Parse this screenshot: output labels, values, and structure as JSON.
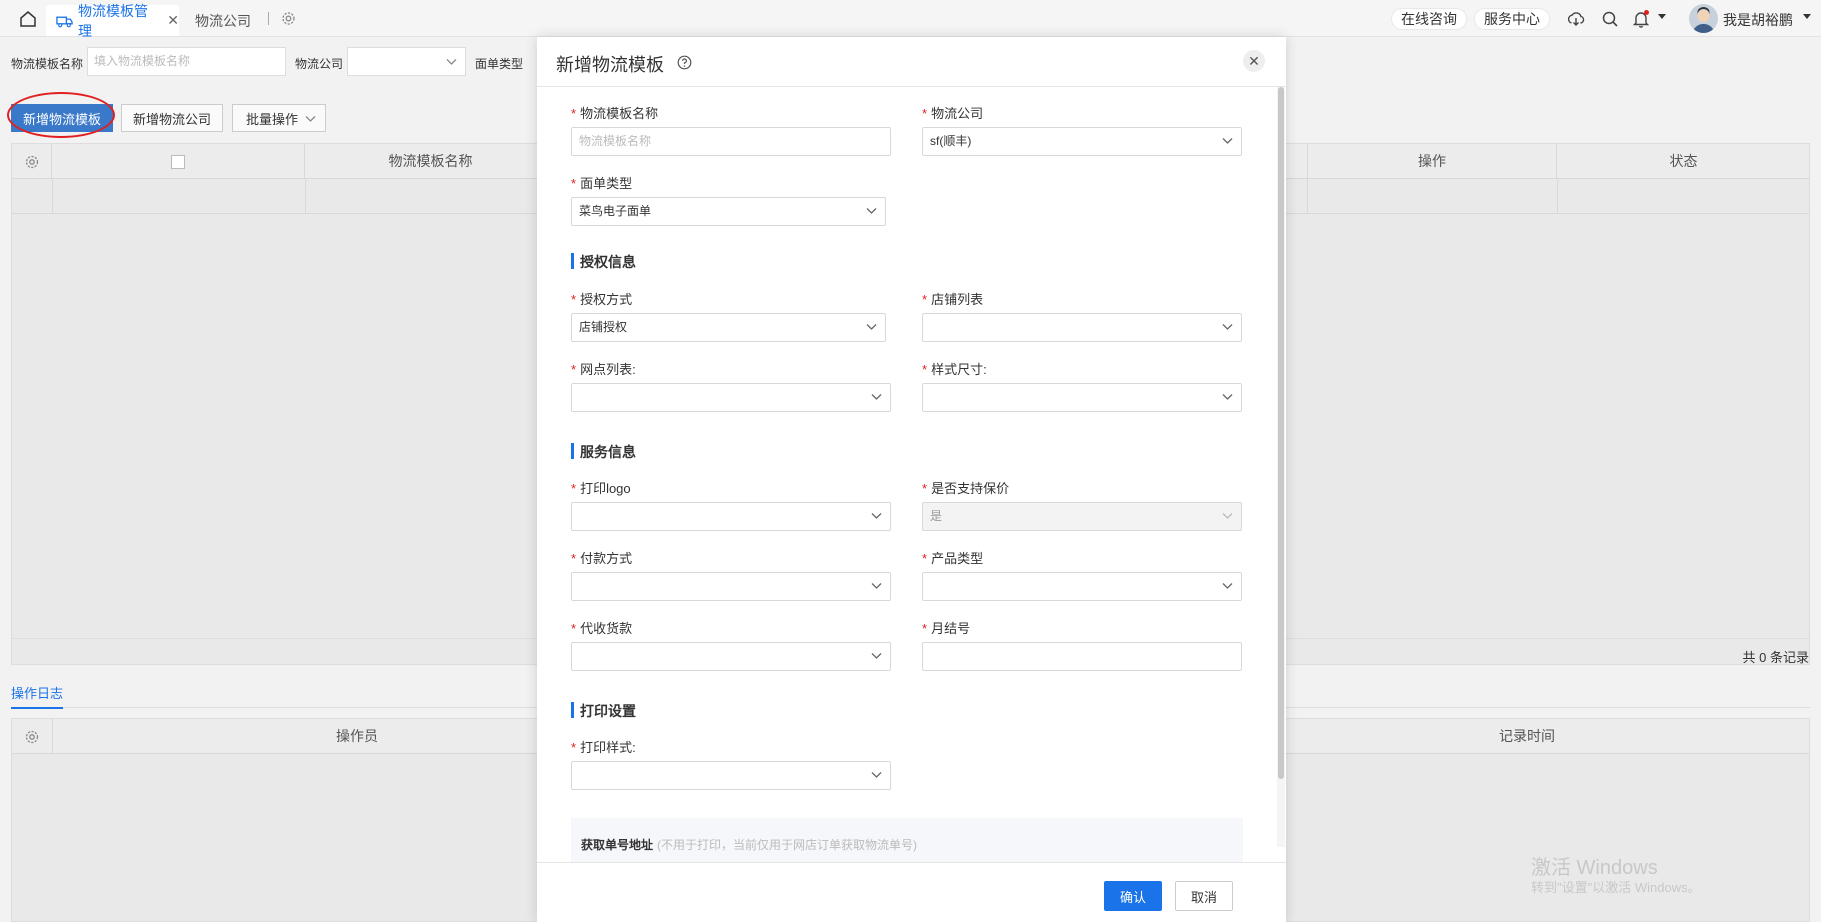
{
  "topbar": {
    "tabs": [
      {
        "label": "物流模板管理",
        "active": true
      },
      {
        "label": "物流公司",
        "active": false
      }
    ],
    "online_consult": "在线咨询",
    "service_center": "服务中心",
    "user_name": "我是胡裕鹏"
  },
  "filters": {
    "template_name_label": "物流模板名称",
    "template_name_placeholder": "填入物流模板名称",
    "company_label": "物流公司",
    "waybill_type_label": "面单类型"
  },
  "toolbar": {
    "add_template": "新增物流模板",
    "add_company": "新增物流公司",
    "batch_ops": "批量操作"
  },
  "table": {
    "columns": [
      "物流模板名称",
      "操作",
      "状态"
    ],
    "total": "共 0 条记录"
  },
  "log": {
    "tab": "操作日志",
    "columns": [
      "操作员",
      "记录时间"
    ]
  },
  "modal": {
    "title": "新增物流模板",
    "fields": {
      "template_name": {
        "label": "物流模板名称",
        "placeholder": "物流模板名称"
      },
      "company": {
        "label": "物流公司",
        "value": "sf(顺丰)"
      },
      "waybill_type": {
        "label": "面单类型",
        "value": "菜鸟电子面单"
      },
      "auth_method": {
        "label": "授权方式",
        "value": "店铺授权"
      },
      "shop_list": {
        "label": "店铺列表",
        "value": ""
      },
      "outlet_list": {
        "label": "网点列表:",
        "value": ""
      },
      "style_size": {
        "label": "样式尺寸:",
        "value": ""
      },
      "print_logo": {
        "label": "打印logo",
        "value": ""
      },
      "insured": {
        "label": "是否支持保价",
        "value": "是"
      },
      "payment": {
        "label": "付款方式",
        "value": ""
      },
      "product_type": {
        "label": "产品类型",
        "value": ""
      },
      "cod": {
        "label": "代收货款",
        "value": ""
      },
      "monthly_no": {
        "label": "月结号",
        "value": ""
      },
      "print_style": {
        "label": "打印样式:",
        "value": ""
      }
    },
    "sections": {
      "auth": "授权信息",
      "service": "服务信息",
      "print": "打印设置"
    },
    "address": {
      "title": "获取单号地址",
      "note": "(不用于打印，当前仅用于网店订单获取物流单号)"
    },
    "confirm": "确认",
    "cancel": "取消"
  },
  "watermark": {
    "line1": "激活 Windows",
    "line2": "转到\"设置\"以激活 Windows。"
  },
  "colors": {
    "accent": "#1a73e8",
    "primary_button": "#3a79c9",
    "required": "#e02020",
    "annotation": "#e02020"
  }
}
